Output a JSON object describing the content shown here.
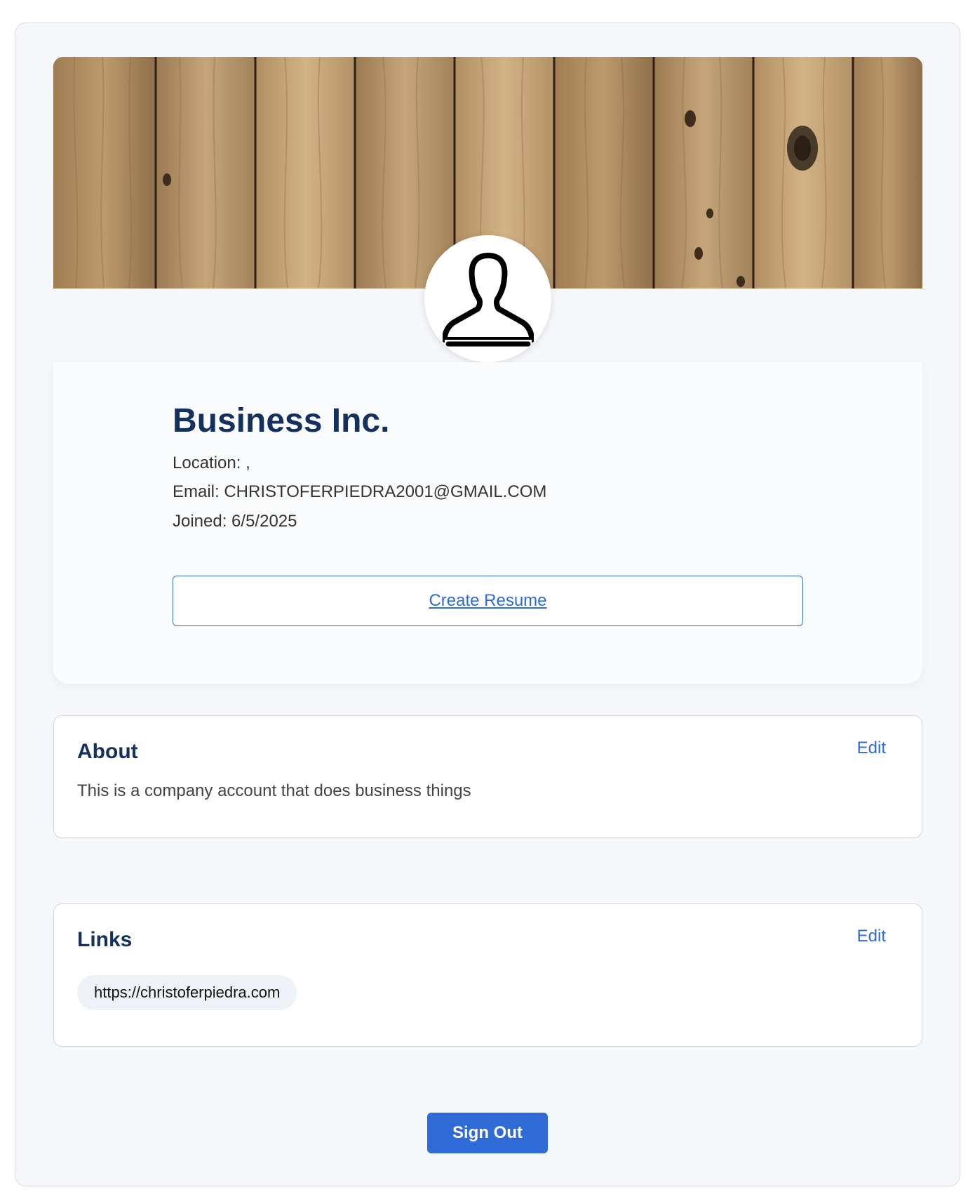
{
  "profile": {
    "name": "Business Inc.",
    "location": "Location: ,",
    "email": "Email: CHRISTOFERPIEDRA2001@GMAIL.COM",
    "joined": "Joined: 6/5/2025",
    "create_resume_label": "Create Resume"
  },
  "banner": {
    "icon": "wood-planks-image"
  },
  "avatar": {
    "icon": "user-silhouette-icon"
  },
  "about": {
    "title": "About",
    "edit_label": "Edit",
    "text": "This is a company account that does business things"
  },
  "links": {
    "title": "Links",
    "edit_label": "Edit",
    "items": [
      "https://christoferpiedra.com"
    ]
  },
  "actions": {
    "sign_out_label": "Sign Out"
  },
  "colors": {
    "accent": "#2f6bd6",
    "heading": "#13305e",
    "page_background": "#f5f7fa",
    "pill_background": "#eef2f7"
  }
}
